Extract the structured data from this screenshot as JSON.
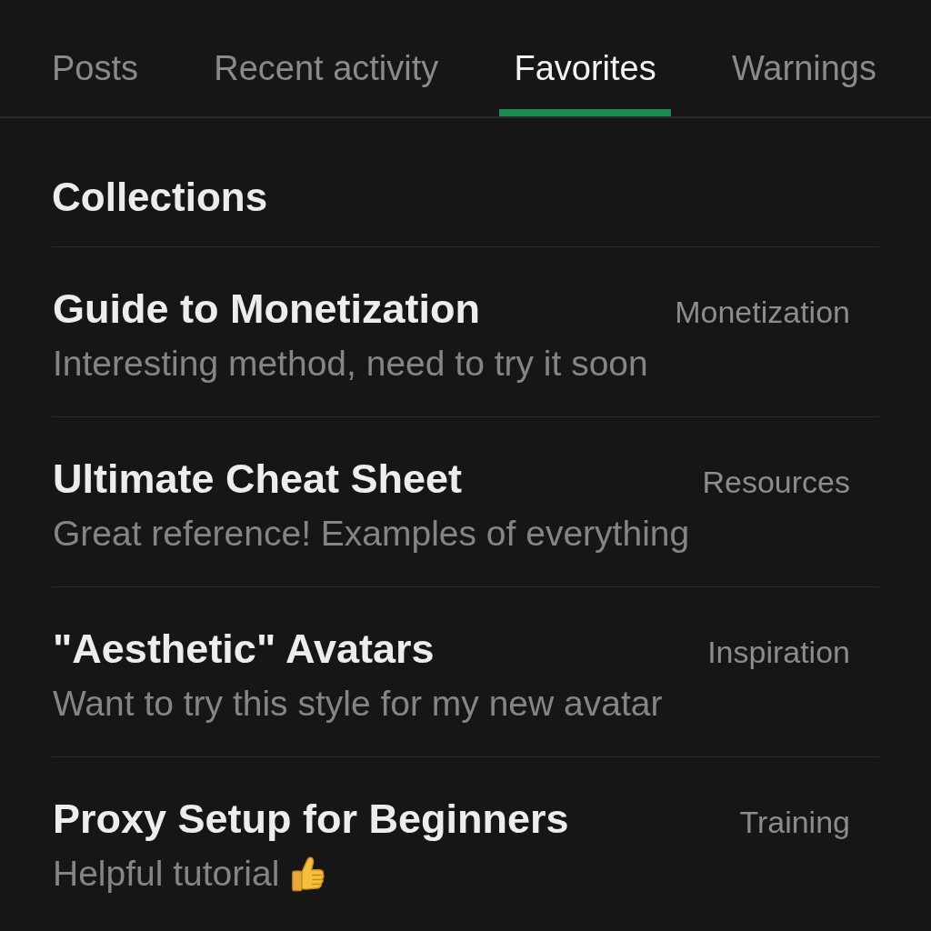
{
  "tabs": [
    {
      "label": "Posts",
      "selected": false
    },
    {
      "label": "Recent activity",
      "selected": false
    },
    {
      "label": "Favorites",
      "selected": true
    },
    {
      "label": "Warnings",
      "selected": false
    }
  ],
  "section": {
    "title": "Collections"
  },
  "items": [
    {
      "title": "Guide to Monetization",
      "tag": "Monetization",
      "note": "Interesting method, need to try it soon",
      "note_icon": false
    },
    {
      "title": "Ultimate Cheat Sheet",
      "tag": "Resources",
      "note": "Great reference! Examples of everything",
      "note_icon": false
    },
    {
      "title": "\"Aesthetic\" Avatars",
      "tag": "Inspiration",
      "note": "Want to try this style for my new avatar",
      "note_icon": false
    },
    {
      "title": "Proxy Setup for Beginners",
      "tag": "Training",
      "note": "Helpful tutorial",
      "note_icon": true
    }
  ]
}
